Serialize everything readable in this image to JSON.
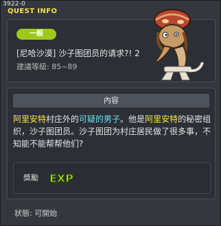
{
  "window": {
    "id": "3922-0",
    "title": "QUEST INFO"
  },
  "quest": {
    "badge": "一般",
    "name": "[尼哈沙漠] 沙子图团员的请求?! 2",
    "level": "建議等級: 85~89"
  },
  "content": {
    "header": "內容",
    "desc": {
      "s1": "阿里安特",
      "s2": "村庄外的",
      "s3": "可疑的男子",
      "s4": "。他是",
      "s5": "阿里安特",
      "s6": "的秘密组织，沙子图团员。沙子图团为村庄居民做了很多事，不知能不能帮帮他们?"
    },
    "reward": {
      "label": "獎勵",
      "exp": "EXP"
    }
  },
  "status": "狀態: 可開始",
  "icons": {
    "npc": "npc-portrait-icon",
    "exp": "exp-icon"
  },
  "colors": {
    "badge": "#9ec81a",
    "title": "#f1e24b",
    "highlight_yellow": "#f4e64a",
    "highlight_cyan": "#6ee0f0"
  }
}
